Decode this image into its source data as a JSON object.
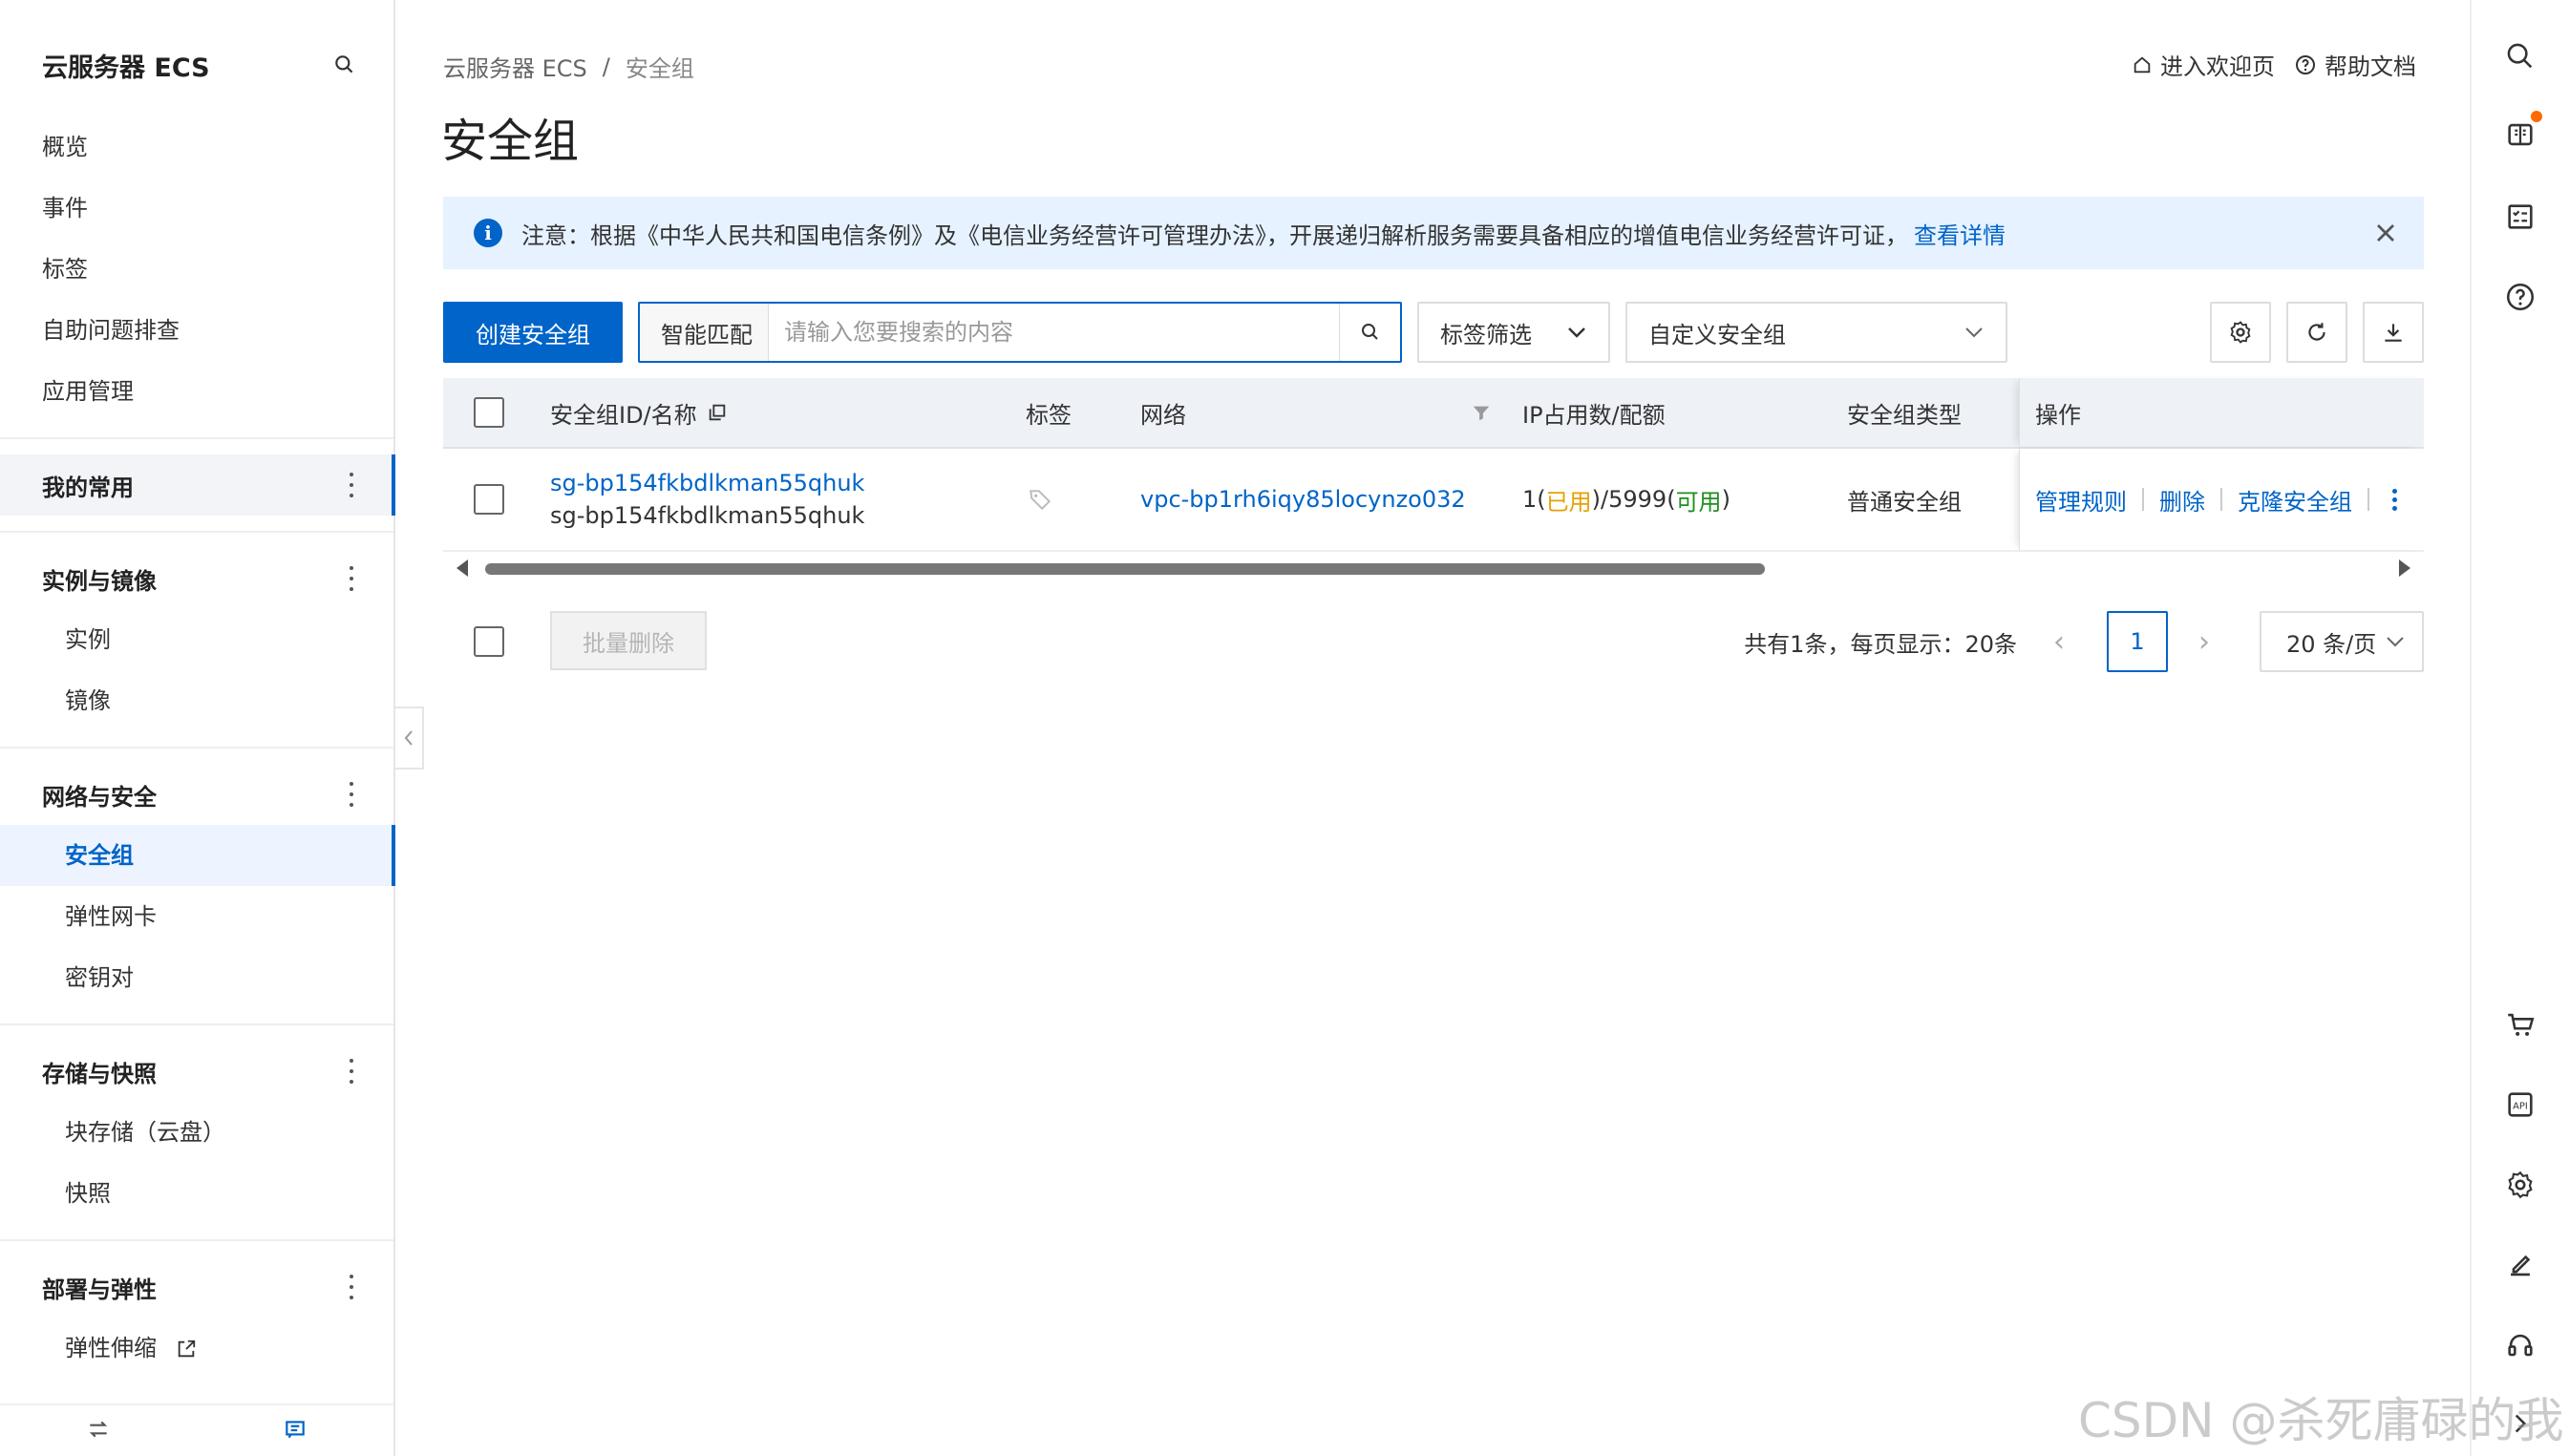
{
  "sidebar": {
    "title": "云服务器 ECS",
    "top_items": [
      "概览",
      "事件",
      "标签",
      "自助问题排查",
      "应用管理"
    ],
    "groups": {
      "mine": "我的常用",
      "instances": {
        "label": "实例与镜像",
        "items": [
          "实例",
          "镜像"
        ]
      },
      "network": {
        "label": "网络与安全",
        "items": [
          "安全组",
          "弹性网卡",
          "密钥对"
        ]
      },
      "storage": {
        "label": "存储与快照",
        "items": [
          "块存储（云盘）",
          "快照"
        ]
      },
      "deploy": {
        "label": "部署与弹性",
        "items": [
          "弹性伸缩"
        ]
      }
    }
  },
  "breadcrumb": {
    "root": "云服务器 ECS",
    "sep": "/",
    "current": "安全组"
  },
  "top_links": {
    "welcome": "进入欢迎页",
    "help": "帮助文档"
  },
  "page_title": "安全组",
  "notice": {
    "text": "注意：根据《中华人民共和国电信条例》及《电信业务经营许可管理办法》，开展递归解析服务需要具备相应的增值电信业务经营许可证，",
    "link": "查看详情"
  },
  "toolbar": {
    "create": "创建安全组",
    "search_mode": "智能匹配",
    "search_placeholder": "请输入您要搜索的内容",
    "tag_filter": "标签筛选",
    "group_select": "自定义安全组"
  },
  "table": {
    "columns": {
      "id": "安全组ID/名称",
      "tag": "标签",
      "network": "网络",
      "ip": "IP占用数/配额",
      "type": "安全组类型",
      "ops": "操作"
    },
    "rows": [
      {
        "id": "sg-bp154fkbdlkman55qhuk",
        "name": "sg-bp154fkbdlkman55qhuk",
        "network": "vpc-bp1rh6iqy85locynzo032",
        "ip_used": "1",
        "ip_used_label": "已用",
        "ip_quota": "5999",
        "ip_avail_label": "可用",
        "type": "普通安全组",
        "ops": [
          "管理规则",
          "删除",
          "克隆安全组"
        ]
      }
    ]
  },
  "footer": {
    "batch_delete": "批量删除",
    "total": "共有1条，每页显示：20条",
    "page": "1",
    "page_size": "20 条/页"
  },
  "watermark": "CSDN @杀死庸碌的我",
  "colors": {
    "primary": "#0064c8",
    "notice_bg": "#e6f2ff",
    "used": "#e6a100",
    "available": "#1f8f1f",
    "badge": "#ff6a00"
  }
}
